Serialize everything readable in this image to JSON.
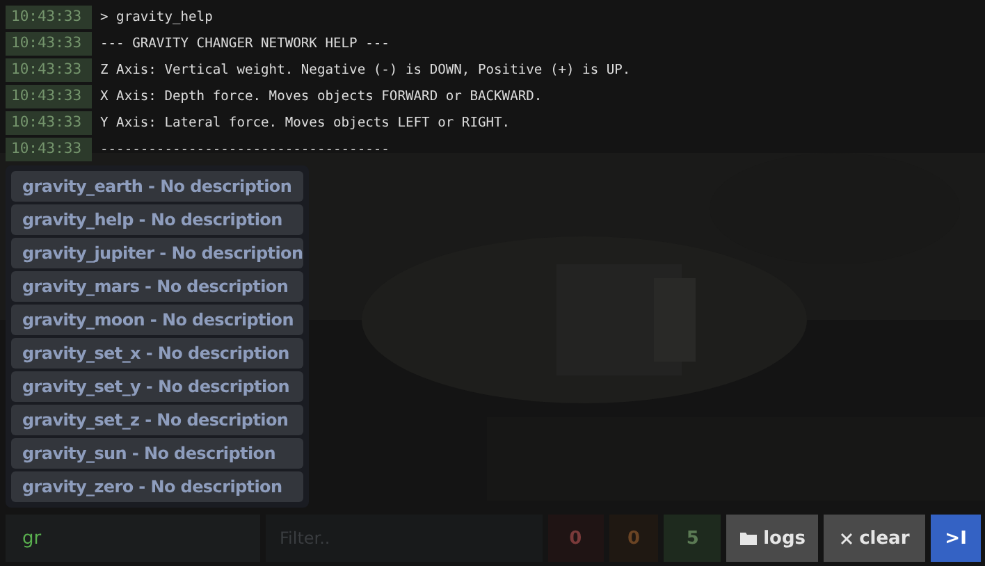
{
  "log": [
    {
      "time": "10:43:33",
      "text": "> gravity_help"
    },
    {
      "time": "10:43:33",
      "text": "--- GRAVITY CHANGER NETWORK HELP ---"
    },
    {
      "time": "10:43:33",
      "text": "Z Axis: Vertical weight. Negative (-) is DOWN, Positive (+) is UP."
    },
    {
      "time": "10:43:33",
      "text": "X Axis: Depth force. Moves objects FORWARD or BACKWARD."
    },
    {
      "time": "10:43:33",
      "text": "Y Axis: Lateral force. Moves objects LEFT or RIGHT."
    },
    {
      "time": "10:43:33",
      "text": "------------------------------------"
    }
  ],
  "suggestions": [
    "gravity_earth - No description",
    "gravity_help - No description",
    "gravity_jupiter - No description",
    "gravity_mars - No description",
    "gravity_moon - No description",
    "gravity_set_x - No description",
    "gravity_set_y - No description",
    "gravity_set_z - No description",
    "gravity_sun - No description",
    "gravity_zero - No description"
  ],
  "command_input": {
    "value": "gr"
  },
  "filter": {
    "placeholder": "Filter.."
  },
  "counters": [
    {
      "kind": "error",
      "count": "0"
    },
    {
      "kind": "warning",
      "count": "0"
    },
    {
      "kind": "info",
      "count": "5"
    }
  ],
  "buttons": [
    {
      "kind": "logs",
      "label": "logs"
    },
    {
      "kind": "clear",
      "label": "clear"
    },
    {
      "kind": "collapse",
      "label": ">I"
    }
  ]
}
